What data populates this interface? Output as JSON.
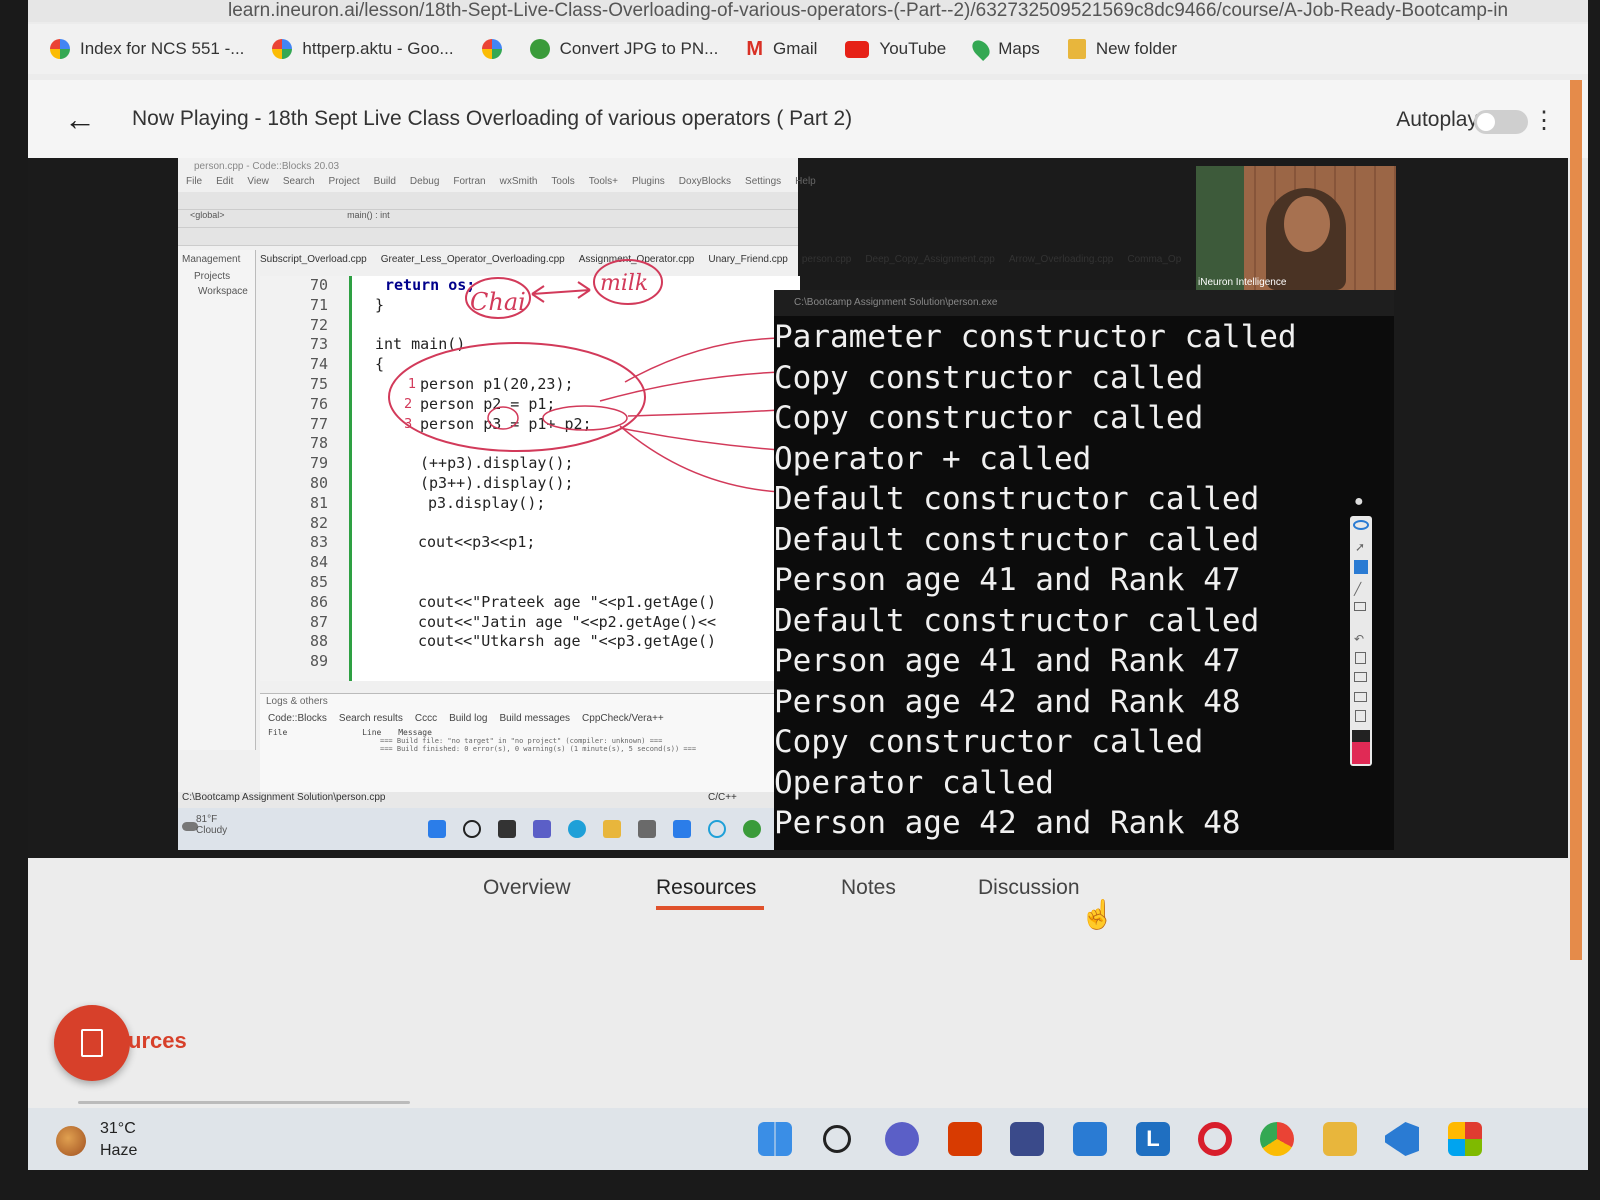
{
  "browser": {
    "url": "learn.ineuron.ai/lesson/18th-Sept-Live-Class-Overloading-of-various-operators-(-Part--2)/632732509521569c8dc9466/course/A-Job-Ready-Bootcamp-in",
    "bookmarks": [
      "Index for NCS 551 -...",
      "httperp.aktu - Goo...",
      "",
      "Convert JPG to PN...",
      "Gmail",
      "YouTube",
      "Maps",
      "New folder"
    ]
  },
  "player": {
    "now_playing": "Now Playing - 18th Sept Live Class Overloading of various operators ( Part 2)",
    "autoplay_label": "Autoplay",
    "autoplay_on": false
  },
  "ide": {
    "window_title": "person.cpp - Code::Blocks 20.03",
    "menu": [
      "File",
      "Edit",
      "View",
      "Search",
      "Project",
      "Build",
      "Debug",
      "Fortran",
      "wxSmith",
      "Tools",
      "Tools+",
      "Plugins",
      "DoxyBlocks",
      "Settings",
      "Help"
    ],
    "scope": "<global>",
    "func": "main() : int",
    "left_panel": [
      "Management",
      "Projects",
      "Workspace"
    ],
    "tabs": [
      "Subscript_Overload.cpp",
      "Greater_Less_Operator_Overloading.cpp",
      "Assignment_Operator.cpp",
      "Unary_Friend.cpp",
      "person.cpp",
      "Deep_Copy_Assignment.cpp",
      "Arrow_Overloading.cpp",
      "Comma_Op"
    ],
    "line_numbers": [
      "70",
      "71",
      "72",
      "73",
      "74",
      "75",
      "76",
      "77",
      "78",
      "79",
      "80",
      "81",
      "82",
      "83",
      "84",
      "85",
      "86",
      "87",
      "88",
      "89"
    ],
    "code": {
      "l70": "return os;",
      "l71": "}",
      "l73": "int main()",
      "l74": "{",
      "l75": "person p1(20,23);",
      "l76": "person p2 = p1;",
      "l77": "person p3 = p1+ p2;",
      "l79": "(++p3).display();",
      "l80": "(p3++).display();",
      "l81": "p3.display();",
      "l83": "cout<<p3<<p1;",
      "l86": "cout<<\"Prateek age \"<<p1.getAge()",
      "l87": "cout<<\"Jatin age \"<<p2.getAge()<<",
      "l88": "cout<<\"Utkarsh age \"<<p3.getAge()"
    },
    "annotations": {
      "left": "Chai",
      "right": "milk",
      "n1": "1",
      "n2": "2",
      "n3": "3"
    },
    "logs_title": "Logs & others",
    "log_tabs": [
      "Code::Blocks",
      "Search results",
      "Cccc",
      "Build log",
      "Build messages",
      "CppCheck/Vera++"
    ],
    "log_header_file": "File",
    "log_header_line": "Line",
    "log_header_msg": "Message",
    "log_line1": "=== Build file: \"no target\" in \"no project\" (compiler: unknown) ===",
    "log_line2": "=== Build finished: 0 error(s), 0 warning(s) (1 minute(s), 5 second(s)) ===",
    "status_path": "C:\\Bootcamp Assignment Solution\\person.cpp",
    "status_lang": "C/C++",
    "inner_weather_temp": "81°F",
    "inner_weather_desc": "Cloudy"
  },
  "console": {
    "title": "C:\\Bootcamp Assignment Solution\\person.exe",
    "lines": [
      "Parameter constructor called",
      "Copy constructor called",
      "Copy constructor called",
      "Operator + called",
      "Default constructor called",
      "Default constructor called",
      "Person age 41 and Rank 47",
      "Default constructor called",
      "Person age 41 and Rank 47",
      "Person age 42 and Rank 48",
      "Copy constructor called",
      "Operator called",
      "Person age 42 and Rank 48"
    ]
  },
  "webcam": {
    "label": "iNeuron Intelligence"
  },
  "lesson_tabs": {
    "overview": "Overview",
    "resources": "Resources",
    "notes": "Notes",
    "discussion": "Discussion",
    "active": "Resources"
  },
  "resources_section": {
    "title": "urces"
  },
  "taskbar": {
    "weather_temp": "31°C",
    "weather_desc": "Haze",
    "icons": [
      "start-icon",
      "search-icon",
      "chat-icon",
      "office-icon",
      "store-icon",
      "mail-icon",
      "l-app-icon",
      "opera-icon",
      "chrome-icon",
      "folder-icon",
      "vscode-icon",
      "apps-icon"
    ]
  },
  "colors": {
    "accent": "#e0512b",
    "ink_annotation": "#d23a5a",
    "console_bg": "#0c0c0c"
  }
}
